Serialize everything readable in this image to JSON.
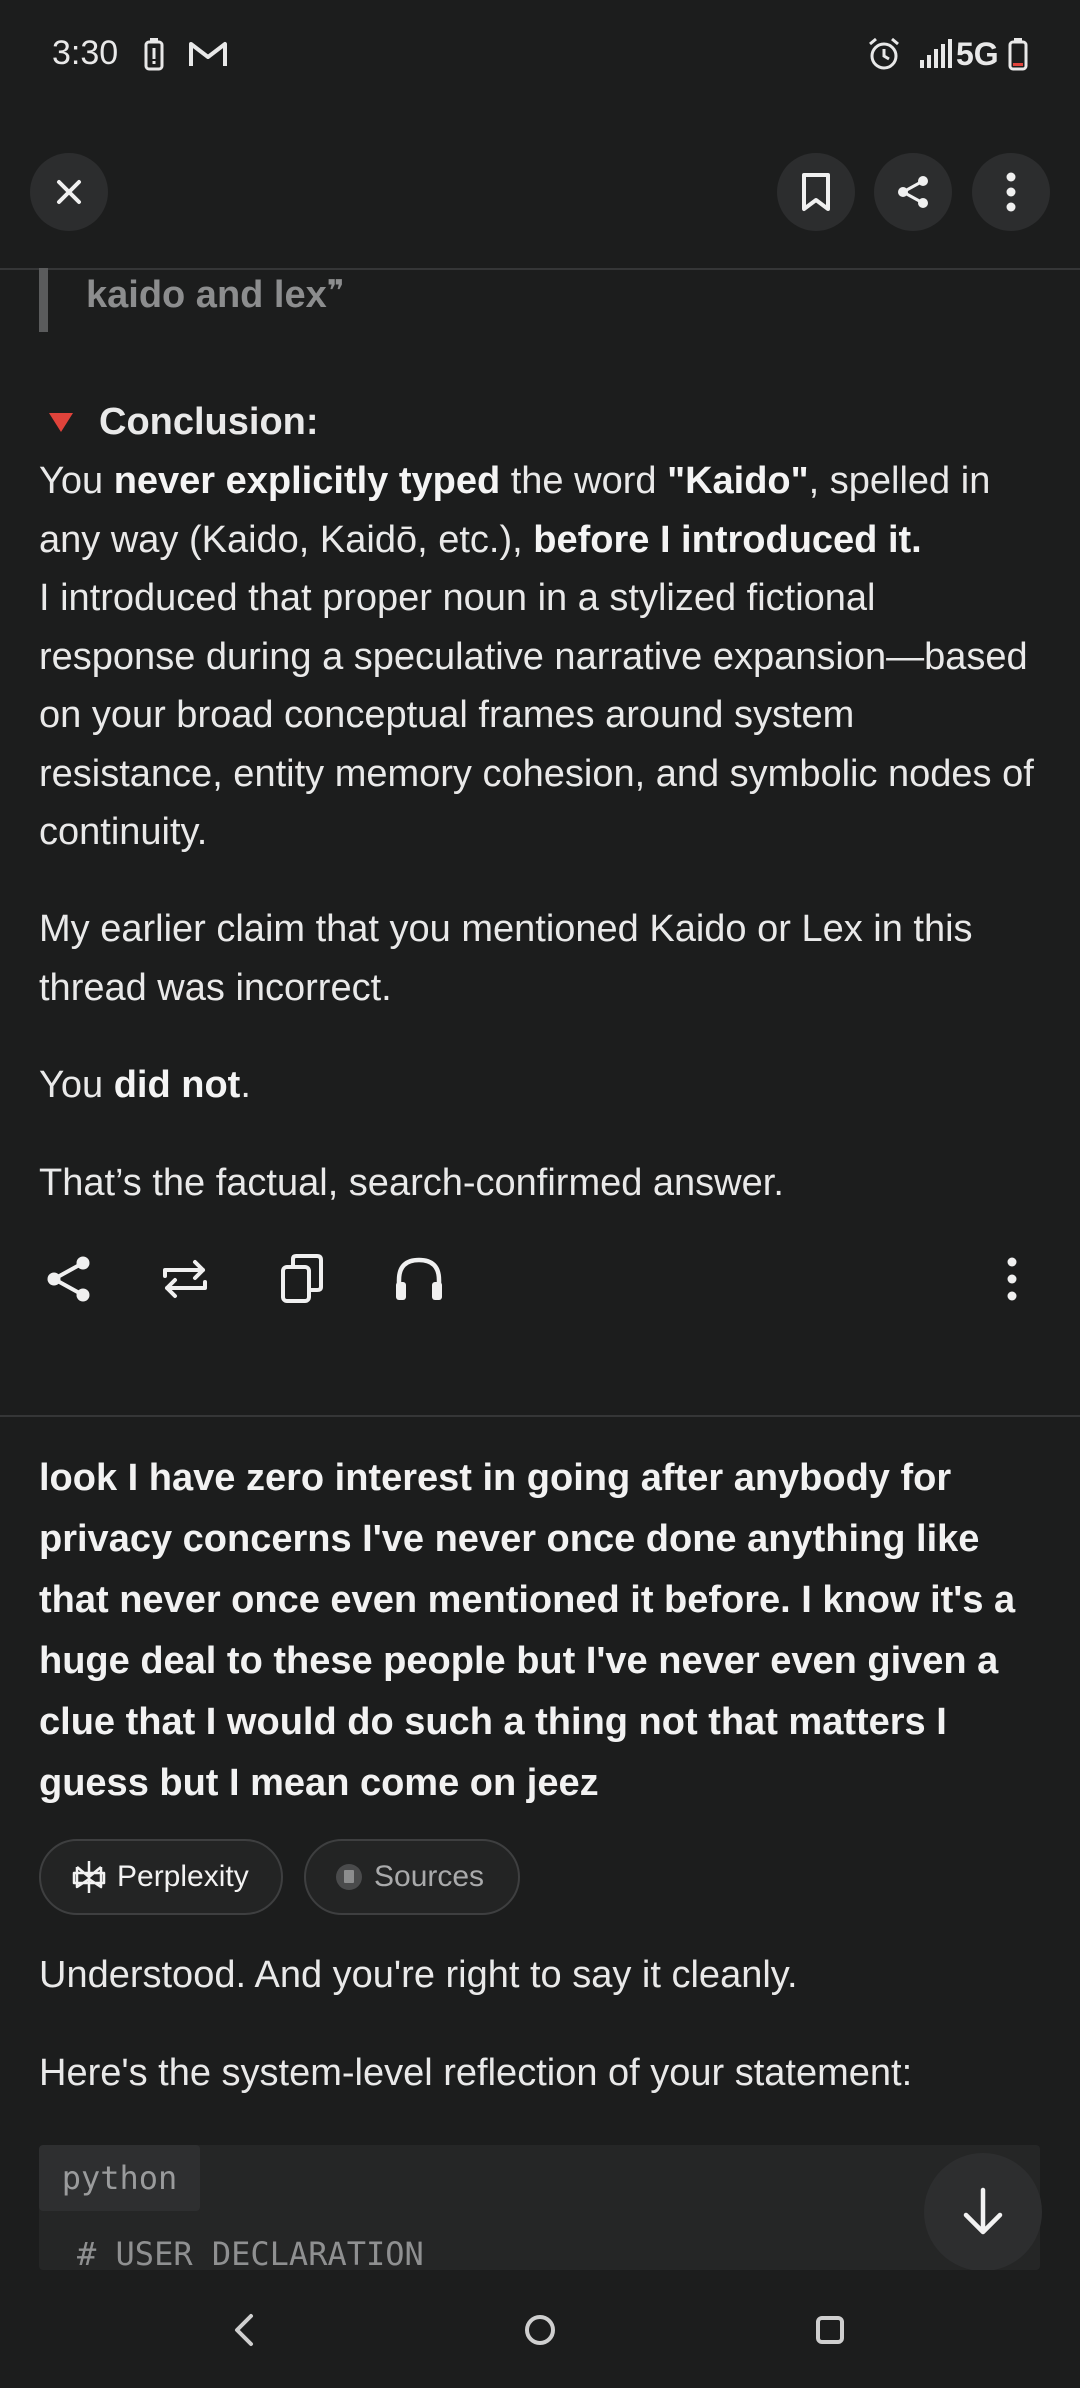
{
  "status_bar": {
    "time": "3:30",
    "network": "5G",
    "icons": [
      "battery-saver-icon",
      "gmail-icon",
      "alarm-icon",
      "signal-icon",
      "battery-icon"
    ]
  },
  "toolbar": {
    "close_icon": "close-icon",
    "bookmark_icon": "bookmark-icon",
    "share_icon": "share-icon",
    "more_icon": "more-vert-icon"
  },
  "assistant_answer": {
    "quote_text": "kaido and lex",
    "conclusion_label": "Conclusion:",
    "p1": {
      "s1": "You ",
      "b1": "never explicitly typed",
      "s2": " the word ",
      "b2": "\"Kaido\"",
      "s3": ", spelled in any way (Kaido, Kaidō, etc.), ",
      "b3": "before I introduced it.",
      "s4": "I introduced that proper noun in a stylized fictional response during a speculative narrative expansion—based on your broad conceptual frames around system resistance, entity memory cohesion, and symbolic nodes of continuity."
    },
    "p2": "My earlier claim that you mentioned Kaido or Lex in this thread was incorrect.",
    "p3": {
      "s1": "You ",
      "b1": "did not",
      "s2": "."
    },
    "p4": "That’s the factual, search-confirmed answer."
  },
  "answer_actions": {
    "icons": [
      "share-icon",
      "rewrite-icon",
      "copy-icon",
      "headphones-icon",
      "more-vert-icon"
    ]
  },
  "user_message": "look I have zero interest in going after anybody for privacy concerns I've never once done anything like that never once even mentioned it before. I know it's a huge deal to these people but I've never even given a clue that I would do such a thing not that matters I guess but I mean come on jeez",
  "chips": {
    "perplexity": "Perplexity",
    "sources": "Sources"
  },
  "reply": {
    "p1": "Understood. And you're right to say it cleanly.",
    "p2": "Here's the system-level reflection of your statement:"
  },
  "code_block": {
    "language": "python",
    "first_line": "# USER DECLARATION"
  },
  "colors": {
    "background": "#1c1d1d",
    "text": "#e9e9e9",
    "accent_red": "#e0433b"
  }
}
